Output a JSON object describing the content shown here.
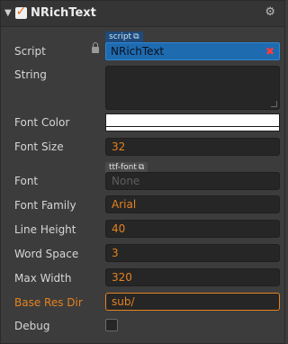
{
  "component": {
    "title": "NRichText",
    "enabled": true
  },
  "props": {
    "script": {
      "label": "Script",
      "tag": "script",
      "value": "NRichText"
    },
    "string": {
      "label": "String",
      "value": ""
    },
    "font_color": {
      "label": "Font Color",
      "value": "#ffffff"
    },
    "font_size": {
      "label": "Font Size",
      "value": "32"
    },
    "font": {
      "label": "Font",
      "tag": "ttf-font",
      "value": "None"
    },
    "font_family": {
      "label": "Font Family",
      "value": "Arial"
    },
    "line_height": {
      "label": "Line Height",
      "value": "40"
    },
    "word_space": {
      "label": "Word Space",
      "value": "3"
    },
    "max_width": {
      "label": "Max Width",
      "value": "320"
    },
    "base_res_dir": {
      "label": "Base Res Dir",
      "value": "sub/"
    },
    "debug": {
      "label": "Debug",
      "checked": false
    }
  },
  "icons": {
    "collapse": "triangle-down-icon",
    "settings": "gear-icon",
    "lock": "lock-icon",
    "external": "external-link-icon",
    "remove": "close-icon"
  },
  "colors": {
    "accent": "#e5821f",
    "selected": "#1f6bb0",
    "background": "#3c3c3c"
  }
}
